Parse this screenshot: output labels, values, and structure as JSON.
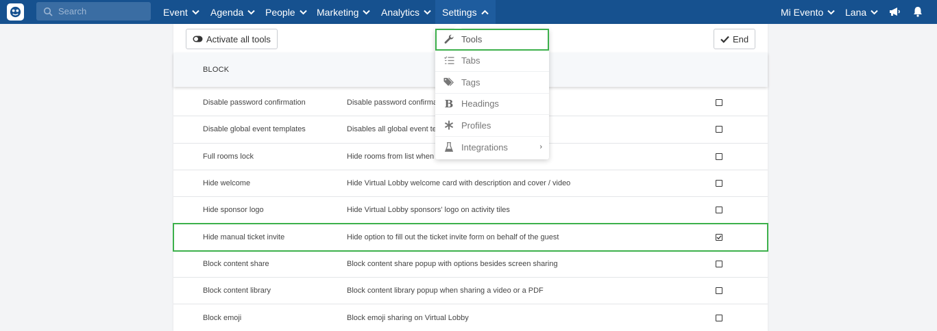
{
  "nav": {
    "search_placeholder": "Search",
    "items": [
      {
        "label": "Event"
      },
      {
        "label": "Agenda"
      },
      {
        "label": "People"
      },
      {
        "label": "Marketing"
      },
      {
        "label": "Analytics"
      },
      {
        "label": "Settings"
      }
    ],
    "event_selector": "Mi Evento",
    "user": "Lana"
  },
  "toolbar": {
    "activate_label": "Activate all tools",
    "end_label": "End"
  },
  "table": {
    "header": "BLOCK",
    "rows": [
      {
        "name": "Disable password confirmation",
        "desc": "Disable password confirmat",
        "checked": false
      },
      {
        "name": "Disable global event templates",
        "desc": "Disables all global event ter",
        "checked": false
      },
      {
        "name": "Full rooms lock",
        "desc": "Hide rooms from list when",
        "checked": false
      },
      {
        "name": "Hide welcome",
        "desc": "Hide Virtual Lobby welcome card with description and cover / video",
        "checked": false
      },
      {
        "name": "Hide sponsor logo",
        "desc": "Hide Virtual Lobby sponsors' logo on activity tiles",
        "checked": false
      },
      {
        "name": "Hide manual ticket invite",
        "desc": "Hide option to fill out the ticket invite form on behalf of the guest",
        "checked": true
      },
      {
        "name": "Block content share",
        "desc": "Block content share popup with options besides screen sharing",
        "checked": false
      },
      {
        "name": "Block content library",
        "desc": "Block content library popup when sharing a video or a PDF",
        "checked": false
      },
      {
        "name": "Block emoji",
        "desc": "Block emoji sharing on Virtual Lobby",
        "checked": false
      }
    ]
  },
  "dropdown": {
    "items": [
      {
        "label": "Tools",
        "icon": "wrench-icon"
      },
      {
        "label": "Tabs",
        "icon": "list-check-icon"
      },
      {
        "label": "Tags",
        "icon": "tags-icon"
      },
      {
        "label": "Headings",
        "icon": "bold-icon"
      },
      {
        "label": "Profiles",
        "icon": "asterisk-icon"
      },
      {
        "label": "Integrations",
        "icon": "flask-icon",
        "submenu": "›"
      }
    ]
  },
  "colors": {
    "nav_bg": "#16518f",
    "highlight": "#3cb04b"
  }
}
